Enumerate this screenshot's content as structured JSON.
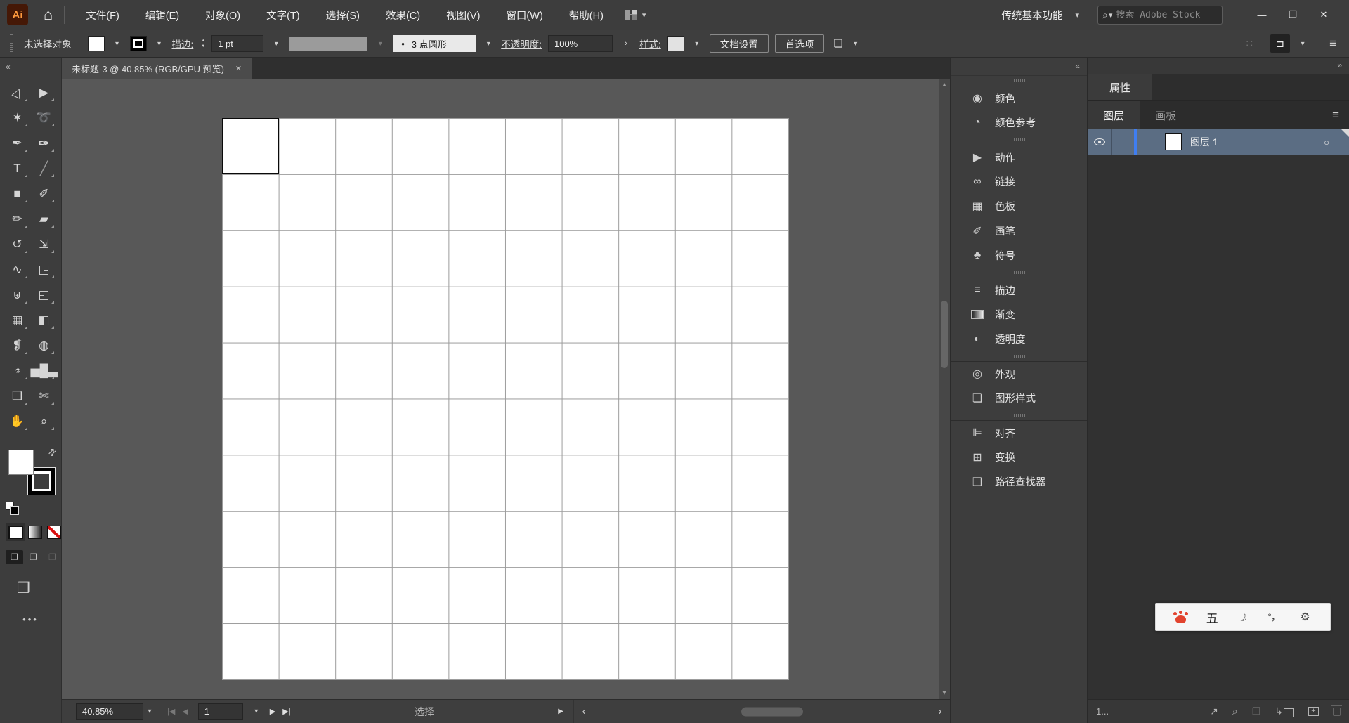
{
  "colors": {
    "accent_blue": "#3f7ef2",
    "layer_row_bg": "#5b6d83",
    "ai_logo_bg": "#451806",
    "ai_logo_fg": "#ff9a3e",
    "ime_paw": "#e2432e",
    "grid_line": "#9c9c9c"
  },
  "app": {
    "logo_text": "Ai",
    "workspace_switcher": "传统基本功能",
    "search_placeholder": "搜索 Adobe Stock"
  },
  "menu_bar": {
    "items": [
      {
        "name": "menu-file",
        "label": "文件(F)"
      },
      {
        "name": "menu-edit",
        "label": "编辑(E)"
      },
      {
        "name": "menu-object",
        "label": "对象(O)"
      },
      {
        "name": "menu-type",
        "label": "文字(T)"
      },
      {
        "name": "menu-select",
        "label": "选择(S)"
      },
      {
        "name": "menu-effect",
        "label": "效果(C)"
      },
      {
        "name": "menu-view",
        "label": "视图(V)"
      },
      {
        "name": "menu-window",
        "label": "窗口(W)"
      },
      {
        "name": "menu-help",
        "label": "帮助(H)"
      }
    ]
  },
  "window_controls": {
    "minimize": "—",
    "restore": "❐",
    "close": "✕"
  },
  "control_bar": {
    "selection_status": "未选择对象",
    "stroke_label": "描边:",
    "stroke_weight": "1 pt",
    "brush_dot": "•",
    "brush_name": "3 点圆形",
    "opacity_label": "不透明度:",
    "opacity_value": "100%",
    "style_label": "样式:",
    "document_setup_button": "文档设置",
    "preferences_button": "首选项"
  },
  "toolbar": {
    "collapse_glyph": "«",
    "tools": [
      {
        "name": "selection-tool",
        "glyph": "▷"
      },
      {
        "name": "direct-selection-tool",
        "glyph": "▶"
      },
      {
        "name": "magic-wand-tool",
        "glyph": "✶"
      },
      {
        "name": "lasso-tool",
        "glyph": "➰"
      },
      {
        "name": "pen-tool",
        "glyph": "✒"
      },
      {
        "name": "curvature-tool",
        "glyph": "✑"
      },
      {
        "name": "type-tool",
        "glyph": "T"
      },
      {
        "name": "line-segment-tool",
        "glyph": "╱"
      },
      {
        "name": "rectangle-tool",
        "glyph": "■"
      },
      {
        "name": "paintbrush-tool",
        "glyph": "✐"
      },
      {
        "name": "pencil-tool",
        "glyph": "✏"
      },
      {
        "name": "eraser-tool",
        "glyph": "▰"
      },
      {
        "name": "rotate-tool",
        "glyph": "↺"
      },
      {
        "name": "scale-tool",
        "glyph": "⇲"
      },
      {
        "name": "width-tool",
        "glyph": "∿"
      },
      {
        "name": "free-transform-tool",
        "glyph": "◳"
      },
      {
        "name": "shape-builder-tool",
        "glyph": "⊎"
      },
      {
        "name": "perspective-grid-tool",
        "glyph": "◰"
      },
      {
        "name": "mesh-tool",
        "glyph": "▦"
      },
      {
        "name": "gradient-tool",
        "glyph": "◧"
      },
      {
        "name": "eyedropper-tool",
        "glyph": "❡"
      },
      {
        "name": "blend-tool",
        "glyph": "◍"
      },
      {
        "name": "symbol-sprayer-tool",
        "glyph": "⚗"
      },
      {
        "name": "column-graph-tool",
        "glyph": "▅█▃"
      },
      {
        "name": "artboard-tool",
        "glyph": "❏"
      },
      {
        "name": "slice-tool",
        "glyph": "✄"
      },
      {
        "name": "hand-tool",
        "glyph": "✋"
      },
      {
        "name": "zoom-tool",
        "glyph": "⌕"
      }
    ],
    "mode_glyph": "❐",
    "screen_mode_glyph": "❒",
    "ellipsis": "•••"
  },
  "document_tab": {
    "title": "未标题-3 @ 40.85% (RGB/GPU 预览)",
    "close_glyph": "✕"
  },
  "canvas": {
    "grid": {
      "columns": 10,
      "rows": 10,
      "selected_cell": {
        "row": 1,
        "col": 1
      }
    }
  },
  "right_strip": {
    "collapse_glyph": "«",
    "panels": [
      {
        "name": "color-panel-button",
        "label": "颜色",
        "glyph": "◉",
        "group_start": "group-start"
      },
      {
        "name": "color-guide-panel-button",
        "label": "颜色参考",
        "glyph": "◔"
      },
      {
        "name": "actions-panel-button",
        "label": "动作",
        "glyph": "▶",
        "group_start": "group-start"
      },
      {
        "name": "links-panel-button",
        "label": "链接",
        "glyph": "∞"
      },
      {
        "name": "swatches-panel-button",
        "label": "色板",
        "glyph": "▦"
      },
      {
        "name": "brushes-panel-button",
        "label": "画笔",
        "glyph": "✐"
      },
      {
        "name": "symbols-panel-button",
        "label": "符号",
        "glyph": "♣"
      },
      {
        "name": "stroke-panel-button",
        "label": "描边",
        "glyph": "≡",
        "group_start": "group-start"
      },
      {
        "name": "gradient-panel-button",
        "label": "渐变",
        "glyph": " ",
        "gradient": "grad"
      },
      {
        "name": "transparency-panel-button",
        "label": "透明度",
        "glyph": "◐"
      },
      {
        "name": "appearance-panel-button",
        "label": "外观",
        "glyph": "◎",
        "group_start": "group-start"
      },
      {
        "name": "graphic-styles-panel-button",
        "label": "图形样式",
        "glyph": "❏"
      },
      {
        "name": "align-panel-button",
        "label": "对齐",
        "glyph": "⊫",
        "group_start": "group-start"
      },
      {
        "name": "transform-panel-button",
        "label": "变换",
        "glyph": "⊞"
      },
      {
        "name": "pathfinder-panel-button",
        "label": "路径查找器",
        "glyph": "❑"
      }
    ]
  },
  "properties_panel": {
    "collapse_glyph": "»",
    "properties_tab": "属性",
    "layers_tab": "图层",
    "artboards_tab": "画板",
    "panel_menu_glyph": "≡",
    "layer": {
      "name": "图层 1",
      "target_glyph": "○"
    },
    "footer": {
      "count_text": "1...",
      "export_glyph": "↗",
      "locate_glyph": "⌕",
      "mask_glyph": "❐",
      "sublayer_glyph": "↳",
      "plus_glyph": "+"
    }
  },
  "status_bar": {
    "zoom": "40.85%",
    "first_glyph": "|◀",
    "prev_glyph": "◀",
    "artboard_number": "1",
    "next_glyph": "▶",
    "last_glyph": "▶|",
    "status_label": "选择",
    "flyout_glyph": "▶",
    "scroll_left_glyph": "‹",
    "scroll_right_glyph": "›"
  },
  "ime_bar": {
    "mode_text": "五",
    "moon_glyph": "☾",
    "punctuation": "°，",
    "gear_glyph": "⚙"
  },
  "glyphs": {
    "home": "⌂",
    "search": "⌕",
    "chevron_down": "▾",
    "chevron_up": "▴",
    "grid_dots": "∷",
    "workspace_icon": "⊐",
    "panel_list": "≡",
    "swap": "⇄"
  }
}
